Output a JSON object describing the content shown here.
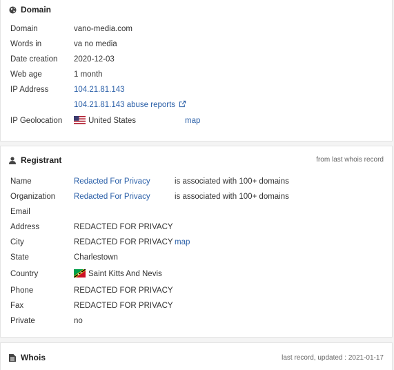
{
  "domain": {
    "title": "Domain",
    "rows": [
      {
        "label": "Domain",
        "value": "vano-media.com"
      },
      {
        "label": "Words in",
        "value": "va no media"
      },
      {
        "label": "Date creation",
        "value": "2020-12-03"
      },
      {
        "label": "Web age",
        "value": "1 month"
      },
      {
        "label": "IP Address",
        "value": "104.21.81.143"
      },
      {
        "label": "",
        "value": "104.21.81.143 abuse reports"
      },
      {
        "label": "IP Geolocation",
        "value": "United States",
        "extra": "map"
      }
    ]
  },
  "registrant": {
    "title": "Registrant",
    "note": "from last whois record",
    "rows": [
      {
        "label": "Name",
        "value": "Redacted For Privacy",
        "extra": "is associated with 100+ domains"
      },
      {
        "label": "Organization",
        "value": "Redacted For Privacy",
        "extra": "is associated with 100+ domains"
      },
      {
        "label": "Email",
        "value": ""
      },
      {
        "label": "Address",
        "value": "REDACTED FOR PRIVACY"
      },
      {
        "label": "City",
        "value": "REDACTED FOR PRIVACY",
        "extra": "map"
      },
      {
        "label": "State",
        "value": "Charlestown"
      },
      {
        "label": "Country",
        "value": "Saint Kitts And Nevis"
      },
      {
        "label": "Phone",
        "value": "REDACTED FOR PRIVACY"
      },
      {
        "label": "Fax",
        "value": "REDACTED FOR PRIVACY"
      },
      {
        "label": "Private",
        "value": "no"
      }
    ]
  },
  "whois": {
    "title": "Whois",
    "note": "last record, updated : 2021-01-17"
  },
  "colors": {
    "link": "#2a5fa8",
    "text": "#333333",
    "border": "#e3e3e3"
  },
  "icons": {
    "domain": "globe-icon",
    "registrant": "user-icon",
    "whois": "document-icon",
    "external": "external-link-icon"
  }
}
